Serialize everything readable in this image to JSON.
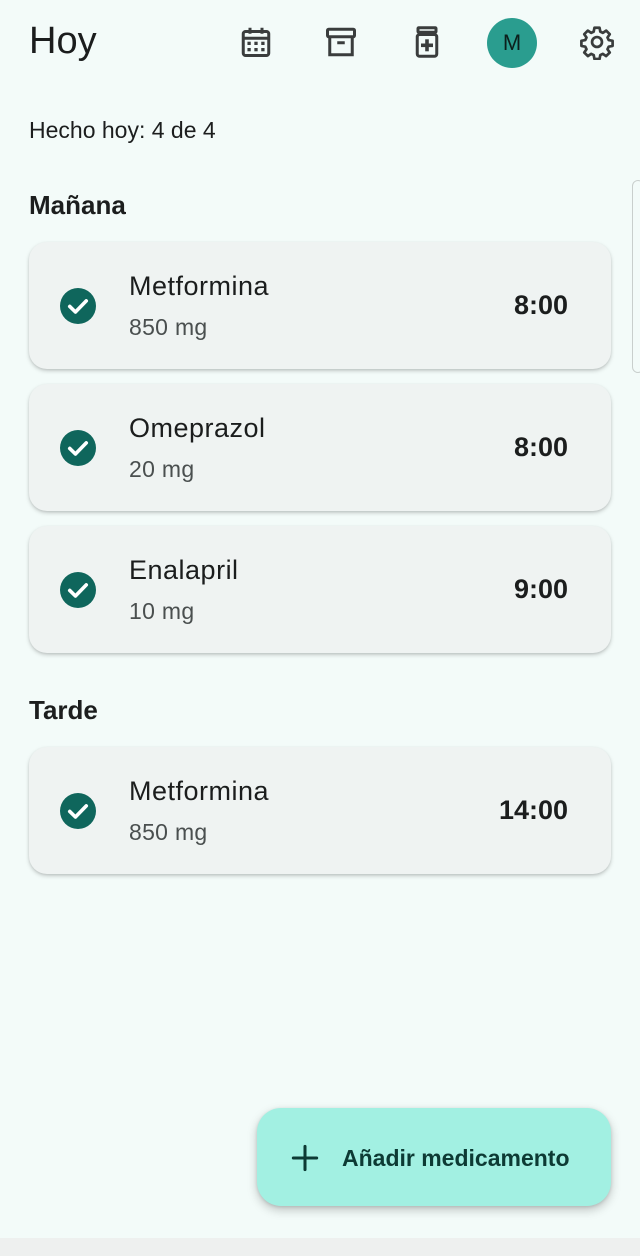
{
  "header": {
    "title": "Hoy",
    "icons": [
      "calendar-icon",
      "archive-icon",
      "medication-icon",
      "avatar",
      "settings-icon"
    ],
    "avatar_initial": "M",
    "avatar_color": "#2a9d8f"
  },
  "summary": "Hecho hoy: 4 de 4",
  "sections": [
    {
      "title": "Mañana",
      "items": [
        {
          "name": "Metformina",
          "dose": "850 mg",
          "time": "8:00",
          "done": true
        },
        {
          "name": "Omeprazol",
          "dose": "20 mg",
          "time": "8:00",
          "done": true
        },
        {
          "name": "Enalapril",
          "dose": "10 mg",
          "time": "9:00",
          "done": true
        }
      ]
    },
    {
      "title": "Tarde",
      "items": [
        {
          "name": "Metformina",
          "dose": "850 mg",
          "time": "14:00",
          "done": true
        }
      ]
    }
  ],
  "fab": {
    "label": "Añadir medicamento",
    "icon": "plus-icon"
  },
  "colors": {
    "background": "#f3fbf9",
    "card": "#eff3f2",
    "check": "#0f665c",
    "fab": "#a2f0e2"
  }
}
